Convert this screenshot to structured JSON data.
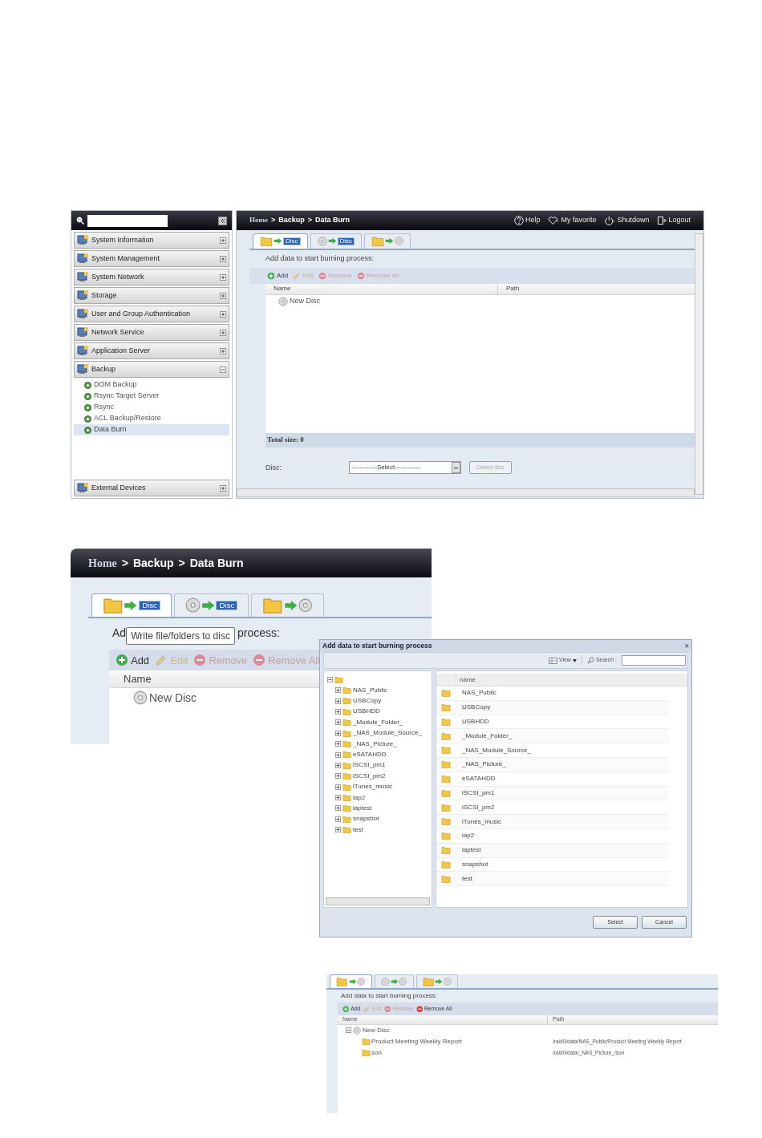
{
  "shot1": {
    "sidebar": {
      "items": [
        {
          "label": "System Information",
          "expanded": false
        },
        {
          "label": "System Management",
          "expanded": false
        },
        {
          "label": "System Network",
          "expanded": false
        },
        {
          "label": "Storage",
          "expanded": false
        },
        {
          "label": "User and Group Authentication",
          "expanded": false
        },
        {
          "label": "Network Service",
          "expanded": false
        },
        {
          "label": "Application Server",
          "expanded": false
        },
        {
          "label": "Backup",
          "expanded": true,
          "children": [
            {
              "label": "DOM Backup",
              "selected": false
            },
            {
              "label": "Rsync Target Server",
              "selected": false
            },
            {
              "label": "Rsync",
              "selected": false
            },
            {
              "label": "ACL Backup/Restore",
              "selected": false
            },
            {
              "label": "Data Burn",
              "selected": true
            }
          ]
        }
      ],
      "bottom_item": {
        "label": "External Devices",
        "expanded": false
      }
    },
    "breadcrumb": [
      "Home",
      "Backup",
      "Data Burn"
    ],
    "separator": ">",
    "top_links": [
      {
        "kind": "help",
        "label": "Help"
      },
      {
        "kind": "favorite",
        "label": "My favorite"
      },
      {
        "kind": "shutdown",
        "label": "Shutdown"
      },
      {
        "kind": "logout",
        "label": "Logout"
      }
    ],
    "tabs": [
      {
        "kind": "folder",
        "label": "Disc",
        "selected": true
      },
      {
        "kind": "disc",
        "label": "Disc",
        "selected": false
      },
      {
        "kind": "folder",
        "selected": false
      }
    ],
    "intro": "Add data to start burning process:",
    "toolbar": [
      {
        "kind": "add",
        "label": "Add",
        "disabled": false
      },
      {
        "kind": "edit",
        "label": "Edit",
        "disabled": true
      },
      {
        "kind": "remove",
        "label": "Remove",
        "disabled": true
      },
      {
        "kind": "remove",
        "label": "Remove All",
        "disabled": true
      }
    ],
    "columns": [
      "Name",
      "Path"
    ],
    "rows": [
      {
        "name": "New Disc"
      }
    ],
    "total": "Total size: 0",
    "disc_label": "Disc:",
    "disc_select": "------------Select------------",
    "detect_button": "Detect disc"
  },
  "shot2": {
    "breadcrumb": [
      "Home",
      "Backup",
      "Data Burn"
    ],
    "separator": ">",
    "tabs": [
      {
        "kind": "folder",
        "label": "Disc",
        "selected": true
      },
      {
        "kind": "disc",
        "label": "Disc",
        "selected": false
      },
      {
        "kind": "folder",
        "selected": false
      }
    ],
    "intro_start": "Ad",
    "tooltip": "Write file/folders to disc",
    "intro_end": "process:",
    "toolbar": [
      {
        "kind": "add",
        "label": "Add",
        "disabled": false
      },
      {
        "kind": "edit",
        "label": "Edit",
        "disabled": true
      },
      {
        "kind": "remove",
        "label": "Remove",
        "disabled": true
      },
      {
        "kind": "remove",
        "label": "Remove All",
        "disabled": true
      }
    ],
    "columns": [
      "Name"
    ],
    "rows": [
      {
        "name": "New Disc"
      }
    ],
    "dialog": {
      "title": "Add data to start burning process",
      "close": "×",
      "view": "View",
      "search_label": "Search :",
      "tree": {
        "expanded": true,
        "children": [
          {
            "label": "NAS_Public",
            "expanded": false
          },
          {
            "label": "USBCopy",
            "expanded": false
          },
          {
            "label": "USBHDD",
            "expanded": false
          },
          {
            "label": "_Module_Folder_",
            "expanded": false
          },
          {
            "label": "_NAS_Module_Source_",
            "expanded": false
          },
          {
            "label": "_NAS_Picture_",
            "expanded": false
          },
          {
            "label": "eSATAHDD",
            "expanded": false
          },
          {
            "label": "iSCSI_pm1",
            "expanded": false
          },
          {
            "label": "iSCSI_pm2",
            "expanded": false
          },
          {
            "label": "iTunes_music",
            "expanded": false
          },
          {
            "label": "iap2",
            "expanded": false
          },
          {
            "label": "iaptest",
            "expanded": false
          },
          {
            "label": "snapshot",
            "expanded": false
          },
          {
            "label": "test",
            "expanded": false
          }
        ]
      },
      "list_column": "name",
      "list": [
        "NAS_Public",
        "USBCopy",
        "USBHDD",
        "_Module_Folder_",
        "_NAS_Module_Source_",
        "_NAS_Picture_",
        "eSATAHDD",
        "iSCSI_pm1",
        "iSCSI_pm2",
        "iTunes_music",
        "iap2",
        "iaptest",
        "snapshot",
        "test"
      ],
      "buttons": [
        "Select",
        "Cancel"
      ]
    }
  },
  "shot3": {
    "tabs": [
      {
        "kind": "folder",
        "selected": true
      },
      {
        "kind": "disc",
        "selected": false
      },
      {
        "kind": "folder",
        "selected": false
      }
    ],
    "intro": "Add data to start burning process:",
    "toolbar": [
      {
        "kind": "add",
        "label": "Add",
        "disabled": false
      },
      {
        "kind": "edit",
        "label": "Edit",
        "disabled": true
      },
      {
        "kind": "remove",
        "label": "Remove",
        "disabled": true
      },
      {
        "kind": "remove",
        "label": "Remove All",
        "disabled": false
      }
    ],
    "columns": [
      "Name",
      "Path"
    ],
    "disc": {
      "name": "New Disc",
      "expanded": true,
      "children": [
        {
          "name": "Product Meeting Weekly Report",
          "path": "/raid0/data/NAS_Public/Product Meeting Weekly Report"
        },
        {
          "name": "son",
          "path": "/raid0/data/_NAS_Picture_/son"
        }
      ]
    }
  }
}
